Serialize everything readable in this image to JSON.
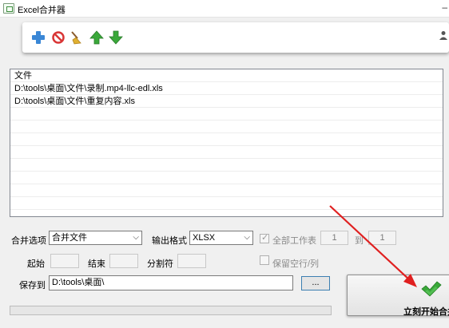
{
  "window": {
    "title": "Excel合并器"
  },
  "file_list": {
    "header": "文件",
    "rows": [
      "D:\\tools\\桌面\\文件\\录制.mp4-llc-edl.xls",
      "D:\\tools\\桌面\\文件\\重复内容.xls"
    ]
  },
  "options": {
    "merge_option_label": "合并选项",
    "merge_option_value": "合并文件",
    "output_format_label": "输出格式",
    "output_format_value": "XLSX",
    "all_sheets_label": "全部工作表",
    "sheet_from": "1",
    "to_label": "到",
    "sheet_to": "1",
    "start_label": "起始",
    "end_label": "结束",
    "separator_label": "分割符",
    "keep_blank_label": "保留空行/列"
  },
  "save": {
    "label": "保存到",
    "path": "D:\\tools\\桌面\\",
    "browse_label": "..."
  },
  "start_button": {
    "label": "立刻开始合并"
  },
  "icons": [
    "add-icon",
    "remove-icon",
    "clear-icon",
    "move-up-icon",
    "move-down-icon",
    "user-icon"
  ],
  "colors": {
    "add": "#3a87d6",
    "remove": "#d93636",
    "arrow": "#3aa83a",
    "annotation": "#e02020"
  }
}
